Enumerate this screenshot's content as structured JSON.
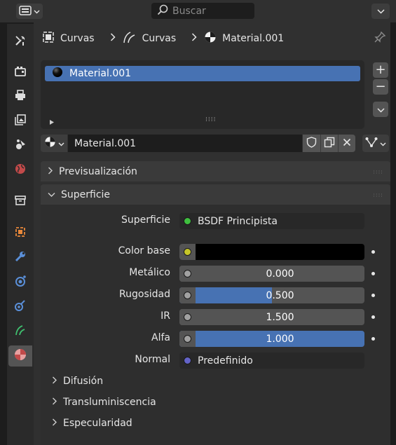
{
  "header": {
    "search_placeholder": "Buscar"
  },
  "breadcrumb": {
    "item1": "Curvas",
    "item2": "Curvas",
    "item3": "Material.001"
  },
  "material_list": {
    "items": [
      {
        "label": "Material.001",
        "selected": true
      }
    ]
  },
  "material_slot": {
    "name": "Material.001"
  },
  "sections": {
    "preview": "Previsualización",
    "surface": "Superficie"
  },
  "surface": {
    "shader_label": "Superficie",
    "shader_value": "BSDF Principista",
    "props": [
      {
        "label": "Color base",
        "value": "",
        "fill": 0,
        "color": "#000000",
        "socket": "#c7c729"
      },
      {
        "label": "Metálico",
        "value": "0.000",
        "fill": 0,
        "socket": "#a1a1a1"
      },
      {
        "label": "Rugosidad",
        "value": "0.500",
        "fill": 0.5,
        "socket": "#a1a1a1"
      },
      {
        "label": "IR",
        "value": "1.500",
        "fill": 0,
        "socket": "#a1a1a1"
      },
      {
        "label": "Alfa",
        "value": "1.000",
        "fill": 1,
        "socket": "#a1a1a1"
      }
    ],
    "normal_label": "Normal",
    "normal_value": "Predefinido"
  },
  "subsections": [
    "Difusión",
    "Transluminiscencia",
    "Especularidad"
  ],
  "colors": {
    "accent": "#4772b3",
    "shader_socket": "#3fbf3f",
    "normal_socket": "#6363c7"
  }
}
